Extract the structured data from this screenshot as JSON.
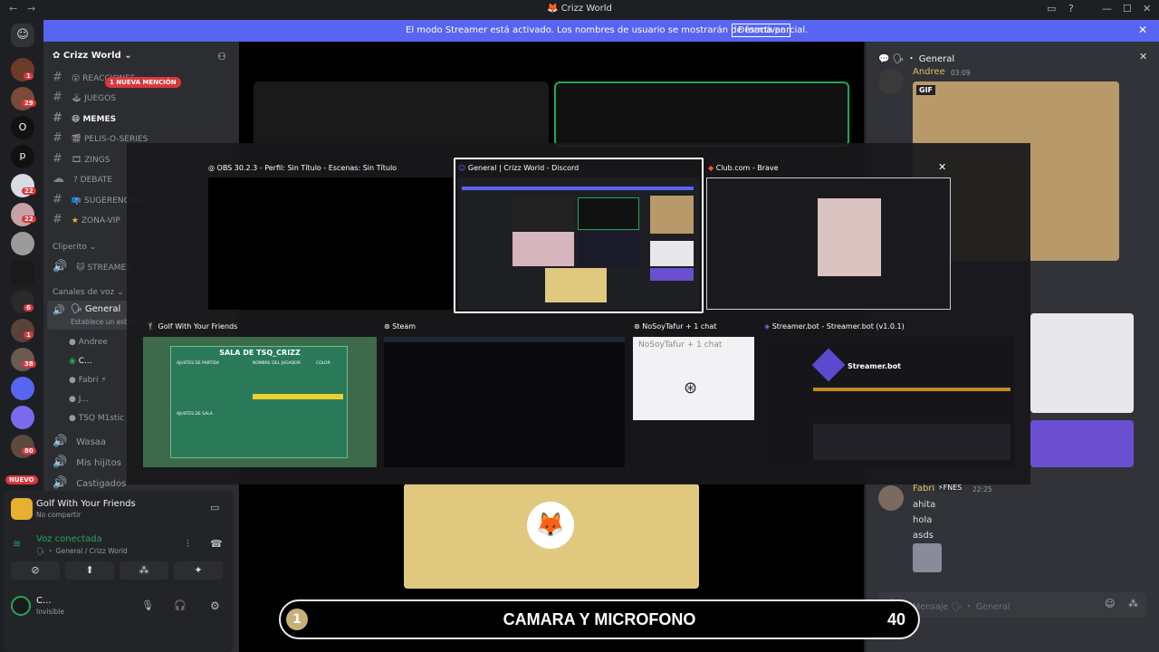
{
  "titlebar": {
    "title": "Crizz World"
  },
  "banner": {
    "message": "El modo Streamer está activado. Los nombres de usuario se mostrarán de forma parcial.",
    "button": "Desactivar"
  },
  "server": {
    "name": "Crizz World",
    "mention_badge": "1 NUEVA MENCIÓN"
  },
  "servers": {
    "badges": [
      "1",
      "29",
      "22",
      "22",
      "6",
      "1",
      "38",
      "80"
    ],
    "letters": [
      "O",
      "p"
    ],
    "new_label": "NUEVO"
  },
  "channels": [
    {
      "name": "REACCIONES",
      "icon": "😮"
    },
    {
      "name": "JUEGOS",
      "icon": "🕹"
    },
    {
      "name": "MEMES",
      "icon": "😄"
    },
    {
      "name": "PELIS-O-SERIES",
      "icon": "🎬"
    },
    {
      "name": "ZINGS",
      "icon": "🎞"
    },
    {
      "name": "DEBATE",
      "icon": "?"
    },
    {
      "name": "SUGERENCIAS",
      "icon": "📪"
    },
    {
      "name": "ZONA-VIP",
      "icon": "★"
    }
  ],
  "categories": {
    "clips": "Cliperito",
    "voice": "Canales de voz"
  },
  "clip_channel": "STREAMER",
  "voice": {
    "channel": "General",
    "status": "Establece un estado",
    "users": [
      "Andree",
      "C...",
      "Fabri",
      "J...",
      "TSQ M1stic"
    ],
    "others": [
      "Wasaa",
      "Mis hijitos",
      "Castigados"
    ]
  },
  "activity": {
    "game": "Golf With Your Friends",
    "status": "No compartir"
  },
  "connection": {
    "label": "Voz conectada",
    "location": "General / Crizz World"
  },
  "user": {
    "name": "C...",
    "status": "Invisible"
  },
  "chat": {
    "header": "General",
    "messages": [
      {
        "author": "Andree",
        "time": "03:09",
        "content": "GIF"
      },
      {
        "author": "Fabri",
        "tag": "FNES",
        "time": "22:25",
        "lines": [
          "ahita",
          "hola",
          "asds"
        ]
      }
    ],
    "input_placeholder": "Mensaje 🗣 ・ General"
  },
  "switcher": {
    "windows": [
      {
        "title": "OBS 30.2.3 - Perfil: Sin Título - Escenas: Sin Título"
      },
      {
        "title": "General | Crizz World - Discord"
      },
      {
        "title": "Club.com - Brave"
      },
      {
        "title": "Golf With Your Friends"
      },
      {
        "title": "Steam"
      },
      {
        "title": "NoSoyTafur + 1 chat"
      },
      {
        "title": "Streamer.bot - Streamer.bot (v1.0.1)"
      }
    ],
    "golf_room": "SALA DE TSQ_CRIZZ",
    "golf_col1": "AJUSTES DE PARTIDA",
    "golf_col2": "NOMBRE DEL JUGADOR",
    "golf_col3": "COLOR",
    "golf_room_settings": "AJUSTES DE SALA",
    "streamerbot_logo": "Streamer.bot",
    "nosoy_text": "NoSoyTafur + 1 chat"
  },
  "overlay": {
    "label": "CAMARA Y MICROFONO",
    "count": "40",
    "prefix": "1"
  }
}
